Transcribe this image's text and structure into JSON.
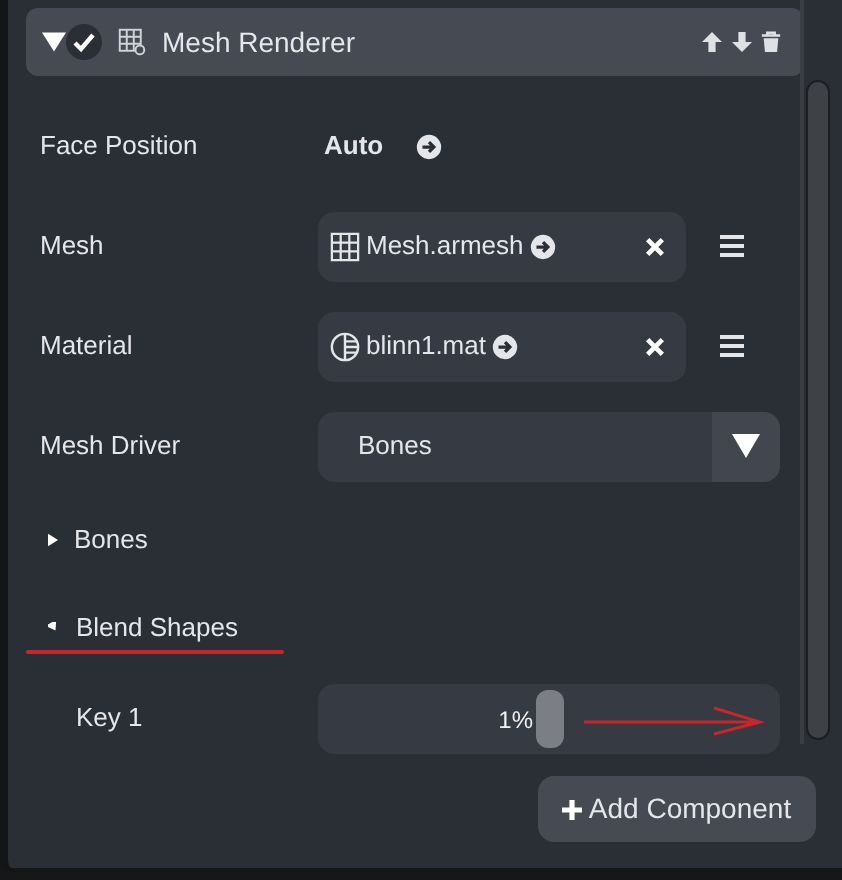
{
  "component": {
    "title": "Mesh Renderer",
    "expanded": true,
    "enabled": true
  },
  "properties": [
    {
      "kind": "value",
      "label": "Face Position",
      "value": "Auto"
    },
    {
      "kind": "mesh_asset",
      "label": "Mesh",
      "value": "Mesh.armesh"
    },
    {
      "kind": "material_asset",
      "label": "Material",
      "value": "blinn1.mat"
    },
    {
      "kind": "dropdown",
      "label": "Mesh Driver",
      "value": "Bones"
    }
  ],
  "sections": [
    {
      "label": "Bones",
      "expanded": false
    },
    {
      "label": "Blend Shapes",
      "expanded": true,
      "children": [
        {
          "label": "Key 1",
          "value": "1%",
          "level": 0.5
        }
      ]
    }
  ],
  "add_button": "Add Component"
}
